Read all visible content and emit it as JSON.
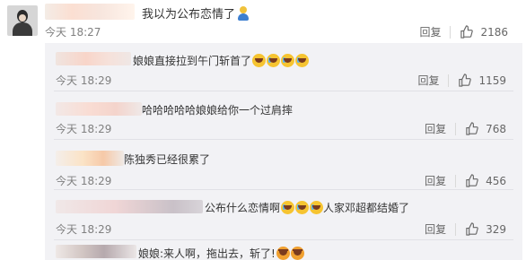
{
  "main_comment": {
    "text": "我以为公布恋情了",
    "emoji": "figure-emoji",
    "time": "今天 18:27",
    "reply_label": "回复",
    "like_count": "2186"
  },
  "replies": [
    {
      "text": "娘娘直接拉到午门斩首了",
      "emojis": [
        "laugh",
        "cry-laugh",
        "cry-laugh",
        "cry-laugh"
      ],
      "time": "今天 18:29",
      "reply_label": "回复",
      "like_count": "1159"
    },
    {
      "text": "哈哈哈哈哈娘娘给你一个过肩摔",
      "emojis": [],
      "time": "今天 18:29",
      "reply_label": "回复",
      "like_count": "768"
    },
    {
      "text": "陈独秀已经很累了",
      "emojis": [],
      "time": "今天 18:29",
      "reply_label": "回复",
      "like_count": "456"
    },
    {
      "text_a": "公布什么恋情啊",
      "text_b": "人家邓超都结婚了",
      "emojis": [
        "cry-laugh",
        "cry-laugh",
        "cry-laugh"
      ],
      "time": "今天 18:29",
      "reply_label": "回复",
      "like_count": "329"
    },
    {
      "text": "娘娘:来人啊，拖出去，斩了!",
      "emojis": [
        "angry",
        "angry"
      ],
      "time": "",
      "reply_label": "",
      "like_count": ""
    }
  ],
  "colors": {
    "panel_bg": "#f2f2f5",
    "time": "#808080",
    "text": "#333333"
  },
  "icons": {
    "like": "thumbs-up-icon"
  }
}
